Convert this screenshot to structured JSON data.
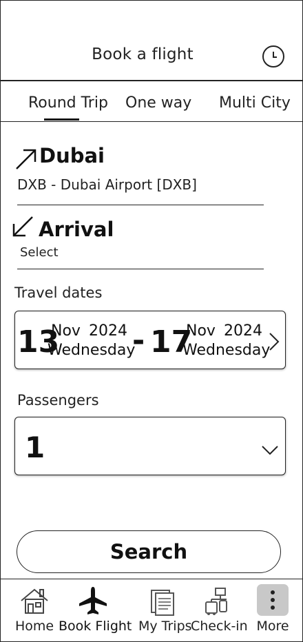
{
  "header": {
    "title": "Book a flight",
    "history_icon": "history-icon"
  },
  "tabs": [
    {
      "label": "Round Trip",
      "active": true
    },
    {
      "label": "One way",
      "active": false
    },
    {
      "label": "Multi City",
      "active": false
    }
  ],
  "origin": {
    "city": "Dubai",
    "airport": "DXB - Dubai Airport [DXB]",
    "icon": "departure-arrow-icon"
  },
  "destination": {
    "title": "Arrival",
    "placeholder": "Select",
    "icon": "arrival-arrow-icon"
  },
  "travel_dates": {
    "label": "Travel dates",
    "start": {
      "day": "13",
      "month": "Nov",
      "year": "2024",
      "weekday": "Wednesday"
    },
    "separator": "-",
    "end": {
      "day": "17",
      "month": "Nov",
      "year": "2024",
      "weekday": "Wednesday"
    }
  },
  "passengers": {
    "label": "Passengers",
    "value": "1"
  },
  "search_label": "Search",
  "nav": [
    {
      "label": "Home",
      "icon": "home-icon",
      "active": false
    },
    {
      "label": "Book Flight",
      "icon": "airplane-icon",
      "active": true
    },
    {
      "label": "My Trips",
      "icon": "documents-icon",
      "active": false
    },
    {
      "label": "Check-in",
      "icon": "luggage-icon",
      "active": false
    },
    {
      "label": "More",
      "icon": "more-icon",
      "active": false
    }
  ],
  "colors": {
    "text": "#111111",
    "border": "#222222",
    "more_bg": "#c8c8c8"
  }
}
